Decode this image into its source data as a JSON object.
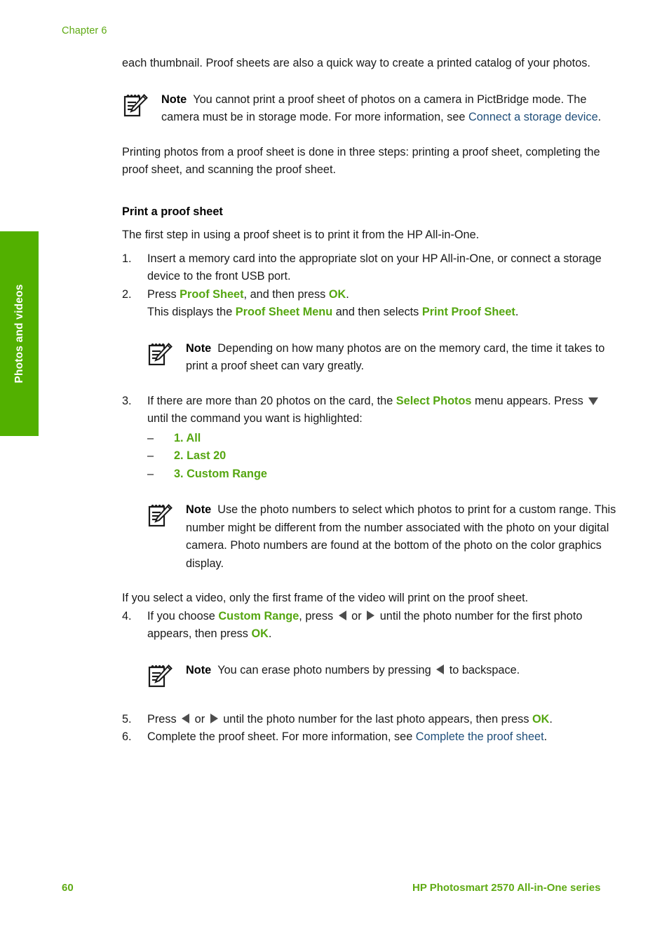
{
  "chapter": {
    "label": "Chapter 6"
  },
  "side_tab": {
    "label": "Photos and videos",
    "color": "#52b000"
  },
  "colors": {
    "keyword_green": "#55a611",
    "link_blue": "#1f4e79",
    "footer_green": "#5faa14",
    "tab_green": "#52b000"
  },
  "body": {
    "intro_paragraph": "each thumbnail. Proof sheets are also a quick way to create a printed catalog of your photos.",
    "note_1": {
      "label": "Note",
      "text_before_link": "You cannot print a proof sheet of photos on a camera in PictBridge mode. The camera must be in storage mode. For more information, see ",
      "link": "Connect a storage device",
      "text_after_link": "."
    },
    "three_steps_paragraph": "Printing photos from a proof sheet is done in three steps: printing a proof sheet, completing the proof sheet, and scanning the proof sheet.",
    "section_heading": "Print a proof sheet",
    "first_step_paragraph": "The first step in using a proof sheet is to print it from the HP All-in-One.",
    "step_1": {
      "number": "1.",
      "text": "Insert a memory card into the appropriate slot on your HP All-in-One, or connect a storage device to the front USB port."
    },
    "step_2": {
      "number": "2.",
      "part_a_pre": "Press ",
      "part_a_kw1": "Proof Sheet",
      "part_a_mid": ", and then press ",
      "part_a_kw2": "OK",
      "part_a_end": ".",
      "part_b_pre": "This displays the ",
      "part_b_kw1": "Proof Sheet Menu",
      "part_b_mid": " and then selects ",
      "part_b_kw2": "Print Proof Sheet",
      "part_b_end": "."
    },
    "note_2": {
      "label": "Note",
      "text": "Depending on how many photos are on the memory card, the time it takes to print a proof sheet can vary greatly."
    },
    "step_3": {
      "number": "3.",
      "line_1_pre": "If there are more than 20 photos on the card, the ",
      "line_1_kw": "Select Photos",
      "line_1_post": " menu appears. Press ",
      "line_1_end": " until the command you want is highlighted:",
      "options": [
        {
          "dash": "–",
          "label": "1. All"
        },
        {
          "dash": "–",
          "label": "2. Last 20"
        },
        {
          "dash": "–",
          "label": "3. Custom Range"
        }
      ]
    },
    "note_3": {
      "label": "Note",
      "text": "Use the photo numbers to select which photos to print for a custom range. This number might be different from the number associated with the photo on your digital camera. Photo numbers are found at the bottom of the photo on the color graphics display."
    },
    "video_paragraph": "If you select a video, only the first frame of the video will print on the proof sheet.",
    "step_4": {
      "number": "4.",
      "pre": "If you choose ",
      "kw1": "Custom Range",
      "mid_1": ", press ",
      "or_text": " or ",
      "mid_2": " until the photo number for the first photo appears, then press ",
      "kw2": "OK",
      "end": "."
    },
    "note_4": {
      "label": "Note",
      "text_pre": "You can erase photo numbers by pressing ",
      "text_post": " to backspace."
    },
    "step_5": {
      "number": "5.",
      "pre": "Press ",
      "or_text": " or ",
      "mid": " until the photo number for the last photo appears, then press ",
      "kw": "OK",
      "end": "."
    },
    "step_6": {
      "number": "6.",
      "pre": "Complete the proof sheet. For more information, see ",
      "link": "Complete the proof sheet",
      "end": "."
    }
  },
  "footer": {
    "page_number": "60",
    "product": "HP Photosmart 2570 All-in-One series"
  },
  "icons": {
    "note": "note-pencil-icon",
    "arrow_down": "arrow-down-icon",
    "arrow_left": "arrow-left-icon",
    "arrow_right": "arrow-right-icon"
  }
}
